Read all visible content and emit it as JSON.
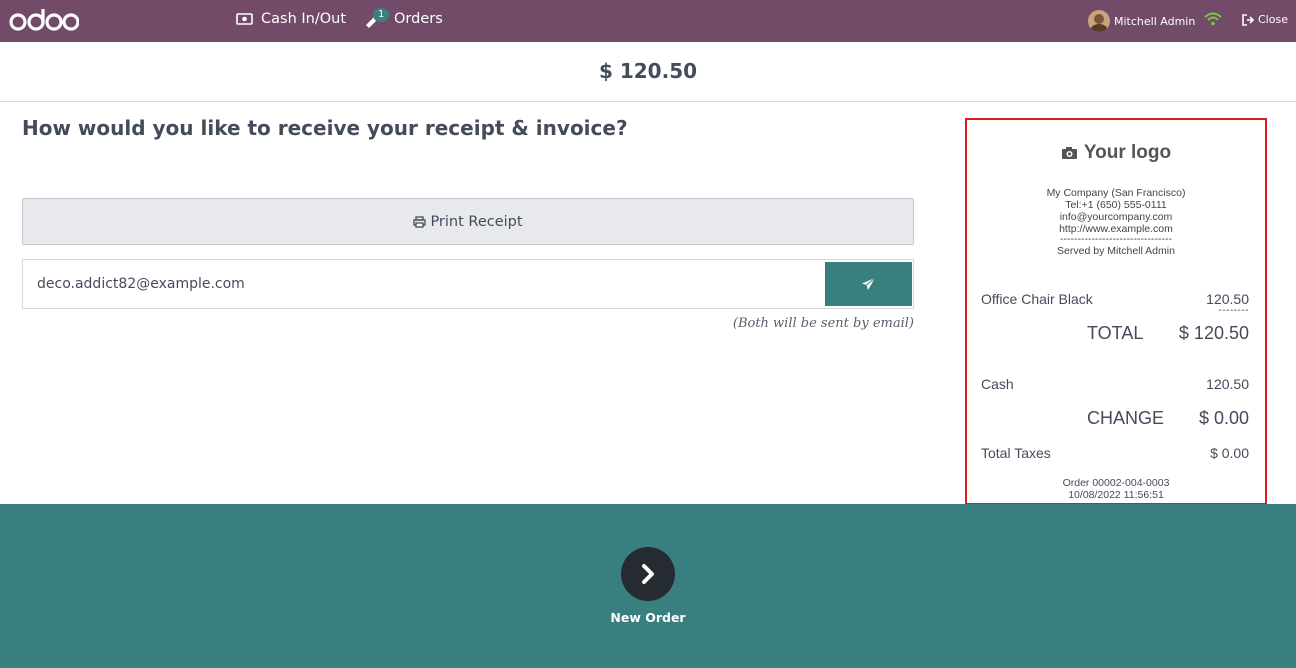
{
  "topbar": {
    "brand": "odoo",
    "cash_label": "Cash In/Out",
    "orders_label": "Orders",
    "orders_badge": "1",
    "user_name": "Mitchell Admin",
    "close_label": "Close",
    "bg_color": "#714b67"
  },
  "amount": "$ 120.50",
  "main": {
    "question": "How would you like to receive your receipt & invoice?",
    "print_label": "Print Receipt",
    "email_value": "deco.addict82@example.com",
    "note": "(Both will be sent by email)"
  },
  "receipt": {
    "logo_text": "Your logo",
    "company_lines": [
      "My Company (San Francisco)",
      "Tel:+1 (650) 555-0111",
      "info@yourcompany.com",
      "http://www.example.com",
      "--------------------------------",
      "Served by Mitchell Admin"
    ],
    "line_item": {
      "name": "Office Chair Black",
      "price": "120.50"
    },
    "dashes": "--------",
    "total_label": "TOTAL",
    "total_value": "$ 120.50",
    "payment": {
      "method": "Cash",
      "amount": "120.50"
    },
    "change_label": "CHANGE",
    "change_value": "$ 0.00",
    "taxes_label": "Total Taxes",
    "taxes_value": "$ 0.00",
    "order_ref": "Order 00002-004-0003",
    "order_date": "10/08/2022 11:56:51",
    "highlight_color": "#e01b1b"
  },
  "footer": {
    "new_order_label": "New Order",
    "bg_color": "#3a7f80"
  }
}
